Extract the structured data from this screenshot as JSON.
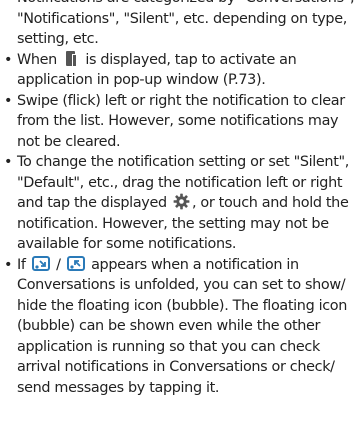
{
  "bullets": [
    {
      "text": "Notifications are categorized by \"Conversations\", \"Notifications\", \"Silent\", etc. depending on type, setting, etc."
    },
    {
      "before": "When",
      "icon": "popup-window-icon",
      "after": "is displayed, tap to activate an application in pop-up window (P.73)."
    },
    {
      "text": "Swipe (flick) left or right the notification to clear from the list. However, some notifications may not be cleared."
    },
    {
      "before": "To change the notification setting or set \"Silent\", \"Default\", etc., drag the notification left or right and tap the displayed",
      "icon": "gear-icon",
      "after": ", or touch and hold the notification. However, the setting may not be available for some notifications."
    },
    {
      "before": "If",
      "icon1": "bubble-expand-icon",
      "separator": "/",
      "icon2": "bubble-collapse-icon",
      "after": "appears when a notification in Conversations is unfolded, you can set to show/ hide the floating icon (bubble). The floating icon (bubble) can be shown even while the other application is running so that you can check arrival notifications in Conversations or check/ send messages by tapping it."
    }
  ],
  "colors": {
    "text": "#222222",
    "bubble_icon": "#2a7ab8"
  }
}
